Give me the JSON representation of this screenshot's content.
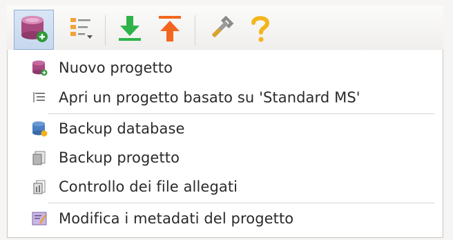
{
  "toolbar": {
    "buttons": [
      {
        "icon": "database-add-icon",
        "active": true
      },
      {
        "icon": "list-settings-icon",
        "active": false
      },
      {
        "icon": "download-arrow-icon",
        "active": false
      },
      {
        "icon": "upload-arrow-icon",
        "active": false
      },
      {
        "icon": "wrench-icon",
        "active": false
      },
      {
        "icon": "help-question-icon",
        "active": false
      }
    ]
  },
  "menu": {
    "accent_color": "#e4775a",
    "items": [
      {
        "label": "Nuovo progetto",
        "icon": "new-project-database-icon"
      },
      {
        "label": "Apri un progetto basato su 'Standard MS'",
        "icon": "template-list-icon"
      },
      {
        "label": "Backup database",
        "icon": "backup-database-icon"
      },
      {
        "label": "Backup progetto",
        "icon": "backup-project-icon"
      },
      {
        "label": "Controllo dei file allegati",
        "icon": "attachments-check-icon"
      },
      {
        "label": "Modifica i metadati del progetto",
        "icon": "edit-metadata-icon"
      }
    ]
  }
}
